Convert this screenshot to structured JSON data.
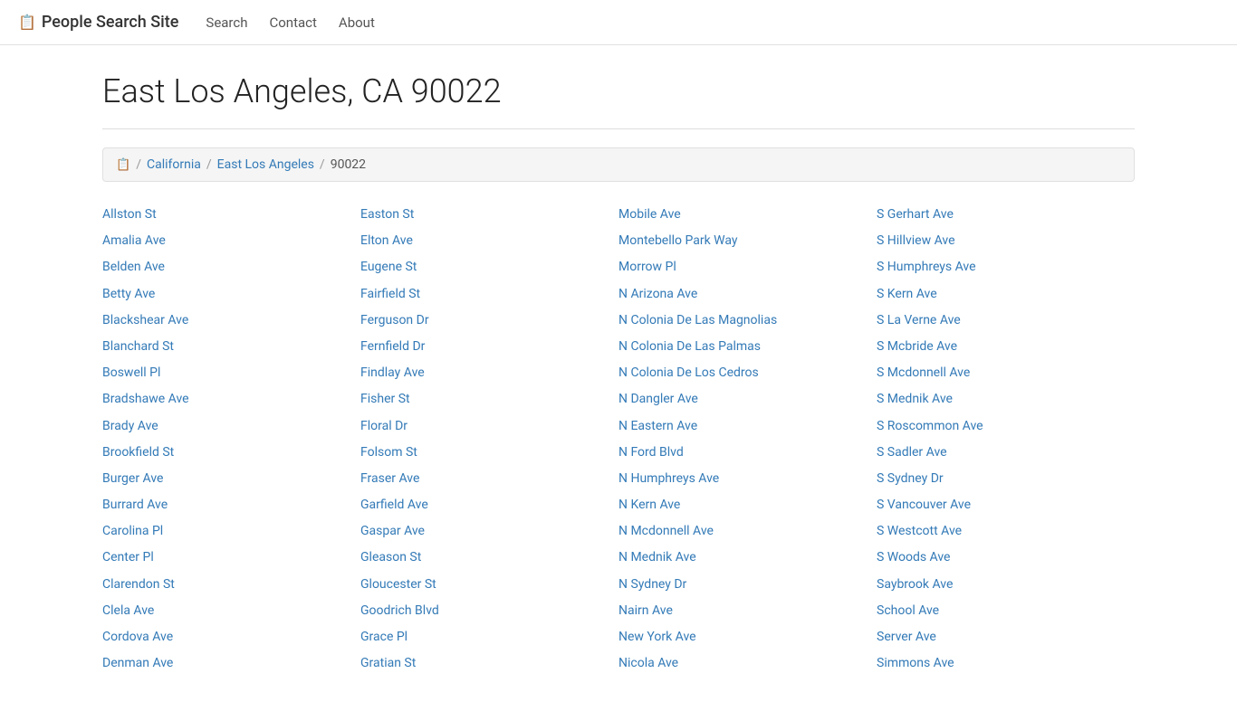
{
  "navbar": {
    "brand": "People Search Site",
    "brand_icon": "📋",
    "nav_items": [
      {
        "label": "Search",
        "href": "#"
      },
      {
        "label": "Contact",
        "href": "#"
      },
      {
        "label": "About",
        "href": "#"
      }
    ]
  },
  "page": {
    "title": "East Los Angeles, CA 90022"
  },
  "breadcrumb": {
    "home_icon": "📋",
    "items": [
      {
        "label": "California",
        "href": "#"
      },
      {
        "label": "East Los Angeles",
        "href": "#"
      },
      {
        "label": "90022",
        "current": true
      }
    ]
  },
  "streets": {
    "col1": [
      "Allston St",
      "Amalia Ave",
      "Belden Ave",
      "Betty Ave",
      "Blackshear Ave",
      "Blanchard St",
      "Boswell Pl",
      "Bradshawe Ave",
      "Brady Ave",
      "Brookfield St",
      "Burger Ave",
      "Burrard Ave",
      "Carolina Pl",
      "Center Pl",
      "Clarendon St",
      "Clela Ave",
      "Cordova Ave",
      "Denman Ave"
    ],
    "col2": [
      "Easton St",
      "Elton Ave",
      "Eugene St",
      "Fairfield St",
      "Ferguson Dr",
      "Fernfield Dr",
      "Findlay Ave",
      "Fisher St",
      "Floral Dr",
      "Folsom St",
      "Fraser Ave",
      "Garfield Ave",
      "Gaspar Ave",
      "Gleason St",
      "Gloucester St",
      "Goodrich Blvd",
      "Grace Pl",
      "Gratian St"
    ],
    "col3": [
      "Mobile Ave",
      "Montebello Park Way",
      "Morrow Pl",
      "N Arizona Ave",
      "N Colonia De Las Magnolias",
      "N Colonia De Las Palmas",
      "N Colonia De Los Cedros",
      "N Dangler Ave",
      "N Eastern Ave",
      "N Ford Blvd",
      "N Humphreys Ave",
      "N Kern Ave",
      "N Mcdonnell Ave",
      "N Mednik Ave",
      "N Sydney Dr",
      "Nairn Ave",
      "New York Ave",
      "Nicola Ave"
    ],
    "col4": [
      "S Gerhart Ave",
      "S Hillview Ave",
      "S Humphreys Ave",
      "S Kern Ave",
      "S La Verne Ave",
      "S Mcbride Ave",
      "S Mcdonnell Ave",
      "S Mednik Ave",
      "S Roscommon Ave",
      "S Sadler Ave",
      "S Sydney Dr",
      "S Vancouver Ave",
      "S Westcott Ave",
      "S Woods Ave",
      "Saybrook Ave",
      "School Ave",
      "Server Ave",
      "Simmons Ave"
    ]
  }
}
